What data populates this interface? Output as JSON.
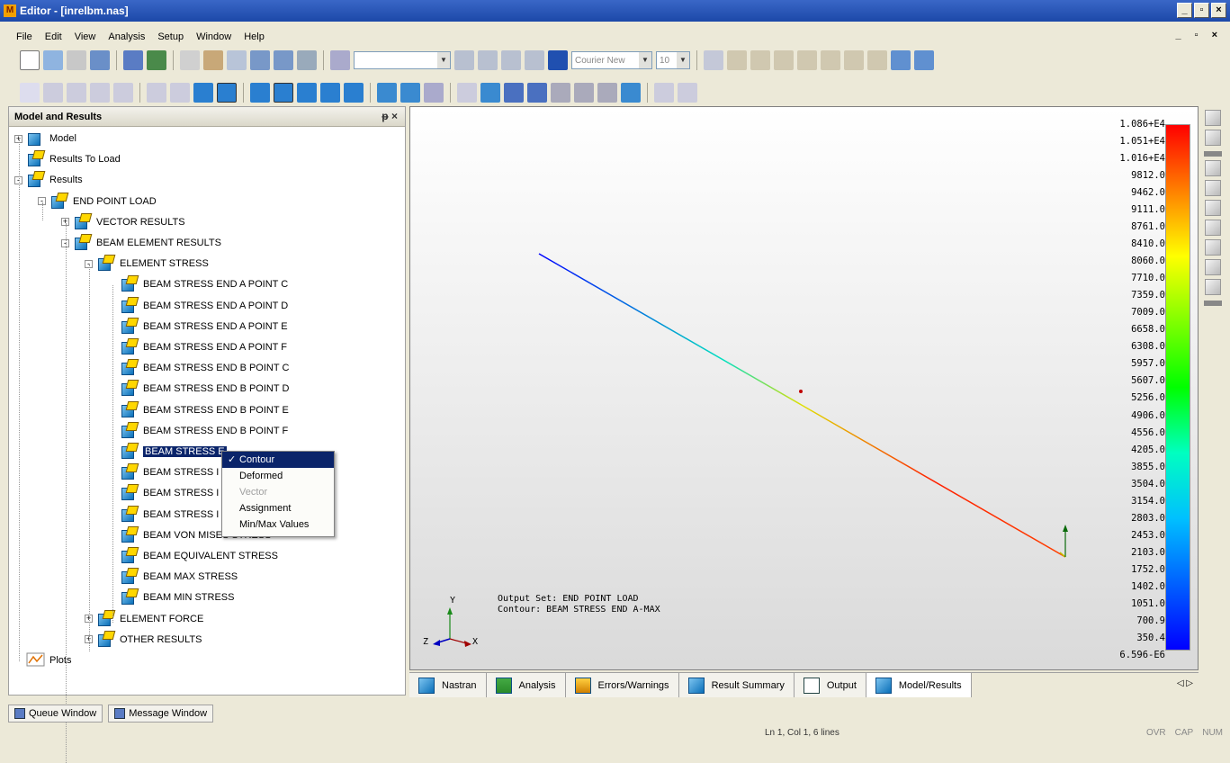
{
  "window": {
    "title": "Editor - [inrelbm.nas]",
    "app_icon": "femap-logo-icon"
  },
  "menu": [
    "File",
    "Edit",
    "View",
    "Analysis",
    "Setup",
    "Window",
    "Help"
  ],
  "toolbar": {
    "font_combo": "Courier New",
    "size_combo": "10"
  },
  "panel": {
    "title": "Model and Results",
    "pin": "ᵽ",
    "close": "×"
  },
  "tree": [
    {
      "label": "Model"
    },
    {
      "label": "Results To Load"
    },
    {
      "label": "Results"
    },
    {
      "label": "END POINT LOAD"
    },
    {
      "label": "VECTOR RESULTS"
    },
    {
      "label": "BEAM ELEMENT RESULTS"
    },
    {
      "label": "ELEMENT STRESS"
    },
    {
      "label": "BEAM STRESS END A POINT C"
    },
    {
      "label": "BEAM STRESS END A POINT D"
    },
    {
      "label": "BEAM STRESS END A POINT E"
    },
    {
      "label": "BEAM STRESS END A POINT F"
    },
    {
      "label": "BEAM STRESS END B POINT C"
    },
    {
      "label": "BEAM STRESS END B POINT D"
    },
    {
      "label": "BEAM STRESS END B POINT E"
    },
    {
      "label": "BEAM STRESS END B POINT F"
    },
    {
      "label": "BEAM STRESS E"
    },
    {
      "label": "BEAM STRESS I"
    },
    {
      "label": "BEAM STRESS I"
    },
    {
      "label": "BEAM STRESS I"
    },
    {
      "label": "BEAM VON MISES STRESS"
    },
    {
      "label": "BEAM EQUIVALENT STRESS"
    },
    {
      "label": "BEAM MAX STRESS"
    },
    {
      "label": "BEAM MIN STRESS"
    },
    {
      "label": "ELEMENT FORCE"
    },
    {
      "label": "OTHER RESULTS"
    },
    {
      "label": "Plots"
    }
  ],
  "context_menu": {
    "items": [
      {
        "label": "Contour",
        "checked": "✓"
      },
      {
        "label": "Deformed"
      },
      {
        "label": "Vector"
      },
      {
        "label": "Assignment"
      },
      {
        "label": "Min/Max Values"
      }
    ]
  },
  "legend": {
    "values": [
      "1.086+E4",
      "1.051+E4",
      "1.016+E4",
      "9812.0",
      "9462.0",
      "9111.0",
      "8761.0",
      "8410.0",
      "8060.0",
      "7710.0",
      "7359.0",
      "7009.0",
      "6658.0",
      "6308.0",
      "5957.0",
      "5607.0",
      "5256.0",
      "4906.0",
      "4556.0",
      "4205.0",
      "3855.0",
      "3504.0",
      "3154.0",
      "2803.0",
      "2453.0",
      "2103.0",
      "1752.0",
      "1402.0",
      "1051.0",
      "700.9",
      "350.4",
      "6.596-E6"
    ],
    "max_color": "#ff0000",
    "min_color": "#0000ff"
  },
  "viewport": {
    "info_line1": "Output Set: END POINT LOAD",
    "info_line2": "Contour: BEAM STRESS END A-MAX",
    "axis_x": "X",
    "axis_y": "Y",
    "axis_z": "Z"
  },
  "bottom_tabs": [
    "Nastran",
    "Analysis",
    "Errors/Warnings",
    "Result Summary",
    "Output",
    "Model/Results"
  ],
  "tab_nav": "◁ ▷",
  "bottom_windows": [
    "Queue Window",
    "Message Window"
  ],
  "status": {
    "position": "Ln 1, Col 1, 6 lines",
    "ovr": "OVR",
    "cap": "CAP",
    "num": "NUM"
  }
}
